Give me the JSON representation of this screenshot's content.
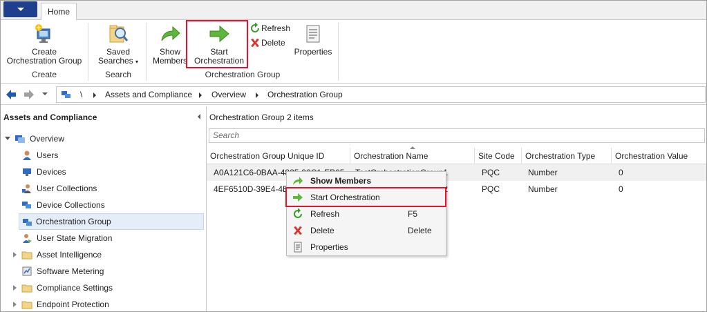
{
  "tabs": [
    {
      "label": "Home"
    }
  ],
  "ribbon": {
    "create_group": {
      "button_label_1": "Create",
      "button_label_2": "Orchestration Group",
      "group_label": "Create"
    },
    "search_group": {
      "button_label_1": "Saved",
      "button_label_2": "Searches",
      "group_label": "Search"
    },
    "orch_group": {
      "show_members_1": "Show",
      "show_members_2": "Members",
      "start_orch_1": "Start",
      "start_orch_2": "Orchestration",
      "refresh": "Refresh",
      "delete": "Delete",
      "properties": "Properties",
      "group_label": "Orchestration Group"
    }
  },
  "address": {
    "root": "\\",
    "crumbs": [
      "Assets and Compliance",
      "Overview",
      "Orchestration Group"
    ]
  },
  "navigation": {
    "title": "Assets and Compliance",
    "items": [
      {
        "label": "Overview",
        "icon": "overview-icon"
      },
      {
        "label": "Users",
        "icon": "users-icon"
      },
      {
        "label": "Devices",
        "icon": "devices-icon"
      },
      {
        "label": "User Collections",
        "icon": "user-collections-icon"
      },
      {
        "label": "Device Collections",
        "icon": "device-collections-icon"
      },
      {
        "label": "Orchestration Group",
        "icon": "orchestration-group-icon"
      },
      {
        "label": "User State Migration",
        "icon": "user-state-migration-icon"
      },
      {
        "label": "Asset Intelligence",
        "icon": "folder-icon"
      },
      {
        "label": "Software Metering",
        "icon": "software-metering-icon"
      },
      {
        "label": "Compliance Settings",
        "icon": "folder-icon"
      },
      {
        "label": "Endpoint Protection",
        "icon": "folder-icon"
      }
    ]
  },
  "content": {
    "title": "Orchestration Group",
    "count": "2 items",
    "search_placeholder": "Search",
    "columns": [
      "Orchestration Group Unique ID",
      "Orchestration Name",
      "Site Code",
      "Orchestration Type",
      "Orchestration Value"
    ],
    "rows": [
      {
        "id": "A0A121C6-0BAA-4825-92C1-EB05",
        "name": "TestOrchestrationGroup1",
        "site": "PQC",
        "type": "Number",
        "value": "0"
      },
      {
        "id": "4EF6510D-39E4-4B8",
        "name": "TestOrchestrationGroup2",
        "site": "PQC",
        "type": "Number",
        "value": "0"
      }
    ]
  },
  "context_menu": {
    "items": [
      {
        "label": "Show Members",
        "shortcut": "",
        "bold": true
      },
      {
        "label": "Start Orchestration",
        "shortcut": ""
      },
      {
        "label": "Refresh",
        "shortcut": "F5"
      },
      {
        "label": "Delete",
        "shortcut": "Delete"
      },
      {
        "label": "Properties",
        "shortcut": ""
      }
    ]
  },
  "colors": {
    "highlight": "#e8112d",
    "app_button": "#1f3f8e",
    "selection": "#e5edf8"
  }
}
